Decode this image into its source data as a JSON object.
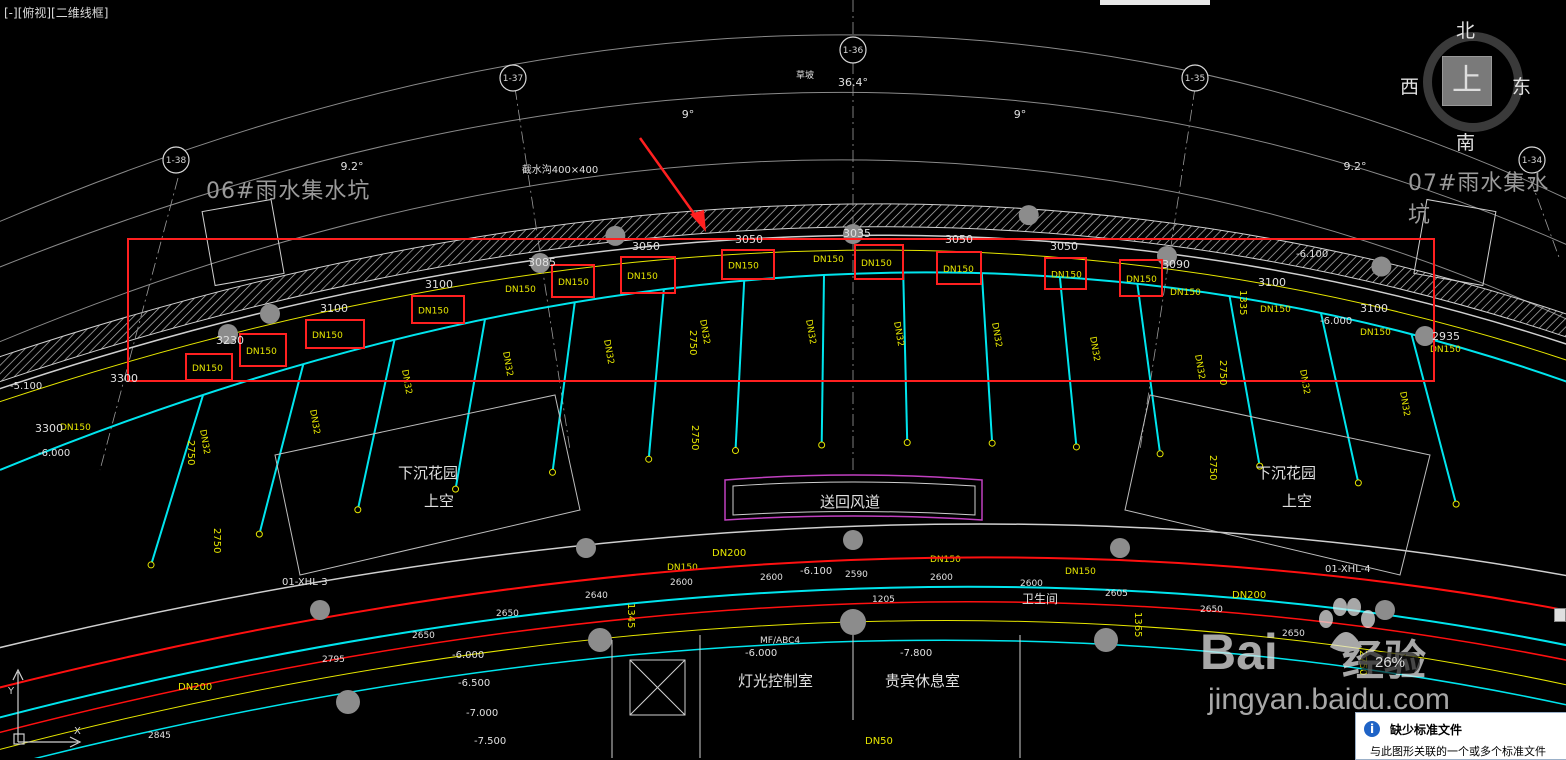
{
  "viewport": {
    "label": "[-][俯视][二维线框]"
  },
  "viewcube": {
    "north": "北",
    "south": "南",
    "east": "东",
    "west": "西",
    "top": "上"
  },
  "tanks": {
    "left": "06#雨水集水坑",
    "right": "07#雨水集水坑"
  },
  "grid_bubbles": [
    "1-38",
    "1-37",
    "1-36",
    "1-35",
    "1-34"
  ],
  "angles": {
    "center": "36.4°",
    "left_half": "9°",
    "right_half": "9°",
    "left_side": "9.2°",
    "right_side": "9.2°"
  },
  "labels": {
    "slope": "草坡",
    "trench": "截水沟400×400"
  },
  "elevations": [
    "-5.100",
    "-6.100",
    "-6.100",
    "-6.000",
    "-6.000",
    "-6.000",
    "-6.000",
    "-6.500",
    "-7.000",
    "-7.500",
    "-7.800"
  ],
  "dims_top": [
    "3300",
    "3230",
    "3100",
    "3100",
    "3085",
    "3050",
    "3050",
    "3035",
    "3050",
    "3050",
    "3090",
    "3100",
    "3100",
    "2935",
    "3300"
  ],
  "dims_mid": [
    "2750",
    "2750",
    "2750",
    "2750",
    "2750",
    "2750",
    "2750",
    "1345",
    "1365",
    "1335"
  ],
  "dims_bottom": [
    "2845",
    "2795",
    "2650",
    "2650",
    "2640",
    "2600",
    "2600",
    "2590",
    "2600",
    "2600",
    "2605",
    "2650",
    "2650",
    "1205"
  ],
  "pipe_labels": {
    "main": "DN150",
    "branch": "DN32",
    "ring": "DN200",
    "bottom": "DN50"
  },
  "highlighted_pipes": [
    "DN150",
    "DN150",
    "DN150",
    "DN150",
    "DN150",
    "DN150",
    "DN150",
    "DN150",
    "DN150",
    "DN150",
    "DN150",
    "DN150"
  ],
  "rooms": {
    "sunken_left": "下沉花园",
    "sunken_left_sub": "上空",
    "sunken_right": "下沉花园",
    "sunken_right_sub": "上空",
    "air_duct": "送回风道",
    "lighting": "灯光控制室",
    "vip_lounge": "贵宾休息室",
    "toilet": "卫生间"
  },
  "tags": {
    "xhl_left": "01-XHL-3",
    "xhl_right": "01-XHL-4",
    "mf": "MF/ABC4"
  },
  "watermark": {
    "brand": "Bai",
    "brand2": "经验",
    "url": "jingyan.baidu.com"
  },
  "zoom": "26%",
  "notification": {
    "title": "缺少标准文件",
    "message": "与此图形关联的一个或多个标准文件"
  },
  "colors": {
    "pipe": "#00e5ee",
    "dim": "#e6e600",
    "highlight": "#ff2020",
    "wall": "#cfcfcf",
    "ring": "#ff1010"
  }
}
